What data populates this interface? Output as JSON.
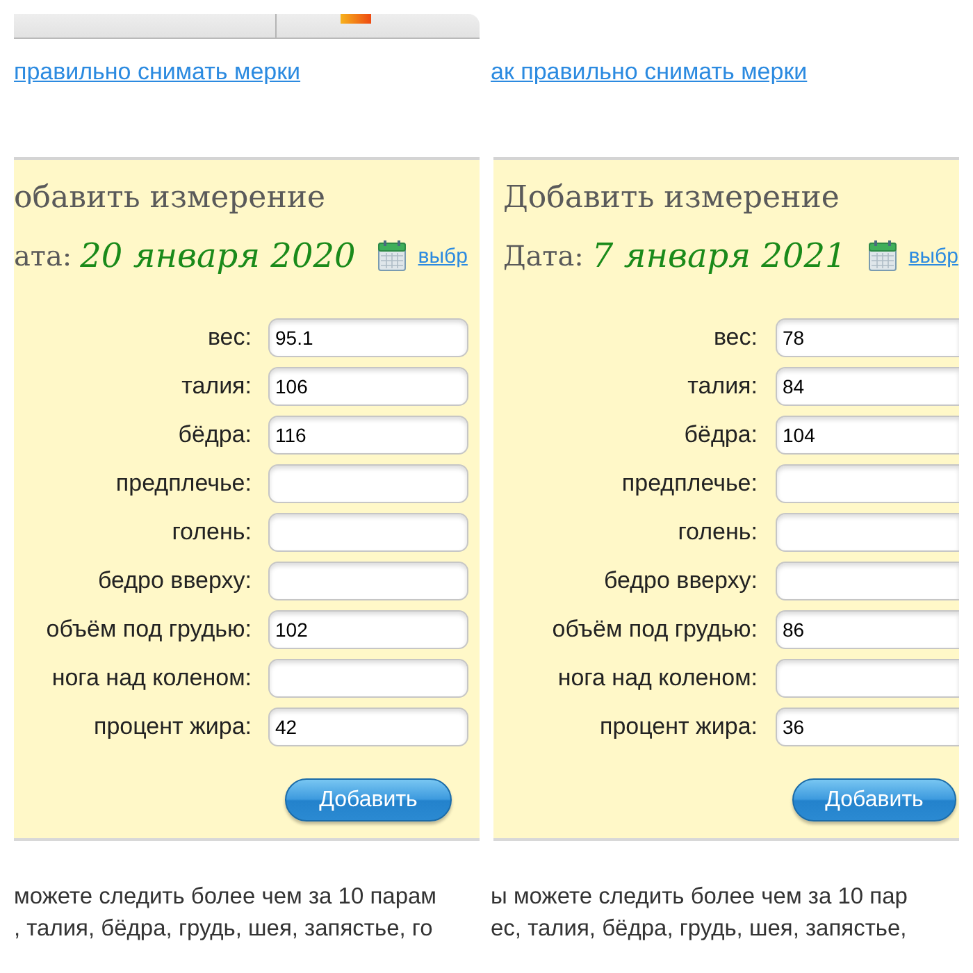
{
  "panels": [
    {
      "tab_strip": true,
      "help_link": "правильно снимать мерки",
      "form": {
        "title": "обавить измерение",
        "date_label": "ата:",
        "date": "20 января 2020",
        "choose_link": "выбр",
        "fields": [
          {
            "label": "вес:",
            "value": "95.1"
          },
          {
            "label": "талия:",
            "value": "106"
          },
          {
            "label": "бёдра:",
            "value": "116"
          },
          {
            "label": "предплечье:"
          },
          {
            "label": "голень:"
          },
          {
            "label": "бедро вверху:"
          },
          {
            "label": "объём под грудью:",
            "value": "102"
          },
          {
            "label": "нога над коленом:"
          },
          {
            "label": "процент жира:",
            "value": "42"
          }
        ],
        "submit": "Добавить"
      },
      "footer_lines": [
        "можете следить более чем за 10 парам",
        ", талия, бёдра, грудь, шея, запястье, го"
      ]
    },
    {
      "tab_strip": false,
      "help_link": "ак правильно снимать мерки",
      "form": {
        "title": "Добавить измерение",
        "date_label": "Дата:",
        "date": "7 января 2021",
        "choose_link": "выбр",
        "fields": [
          {
            "label": "вес:",
            "value": "78"
          },
          {
            "label": "талия:",
            "value": "84"
          },
          {
            "label": "бёдра:",
            "value": "104"
          },
          {
            "label": "предплечье:"
          },
          {
            "label": "голень:"
          },
          {
            "label": "бедро вверху:"
          },
          {
            "label": "объём под грудью:",
            "value": "86"
          },
          {
            "label": "нога над коленом:"
          },
          {
            "label": "процент жира:",
            "value": "36"
          }
        ],
        "submit": "Добавить"
      },
      "footer_lines": [
        "ы можете следить более чем за 10 пар",
        "ес, талия, бёдра, грудь, шея, запястье,"
      ]
    }
  ]
}
